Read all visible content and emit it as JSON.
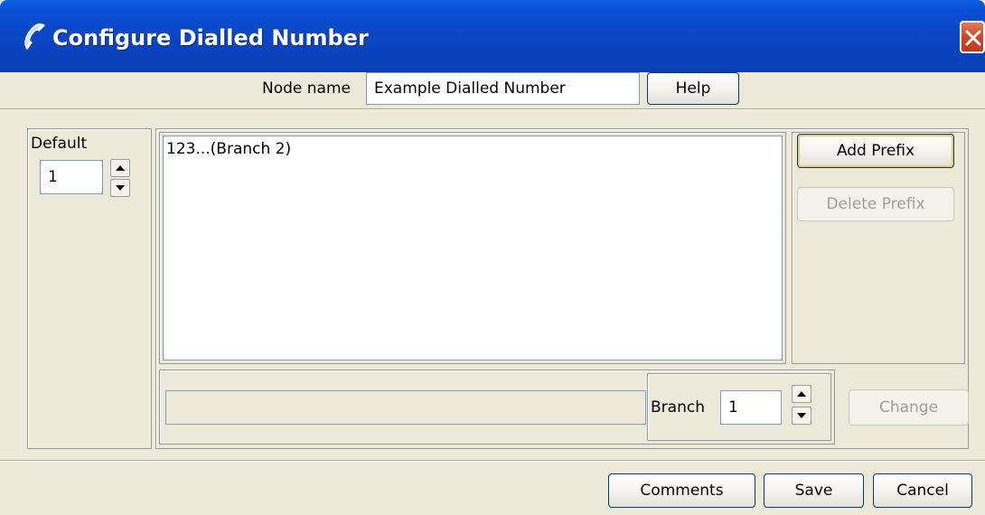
{
  "window": {
    "title": "Configure Dialled Number",
    "title_icon": "phone-handset-icon",
    "close_icon": "close-icon",
    "colors": {
      "titlebar": "#0a44c2",
      "close": "#d2452a",
      "body": "#ece9d8"
    }
  },
  "node_name": {
    "label": "Node name",
    "value": "Example Dialled Number",
    "help_label": "Help"
  },
  "default_panel": {
    "label": "Default",
    "value": "1"
  },
  "prefix_list": {
    "items": [
      "123...(Branch 2)"
    ]
  },
  "prefix_buttons": {
    "add_label": "Add Prefix",
    "delete_label": "Delete Prefix"
  },
  "edit_row": {
    "prefix_value": "",
    "branch_label": "Branch",
    "branch_value": "1",
    "change_label": "Change"
  },
  "footer": {
    "comments_label": "Comments",
    "save_label": "Save",
    "cancel_label": "Cancel"
  }
}
